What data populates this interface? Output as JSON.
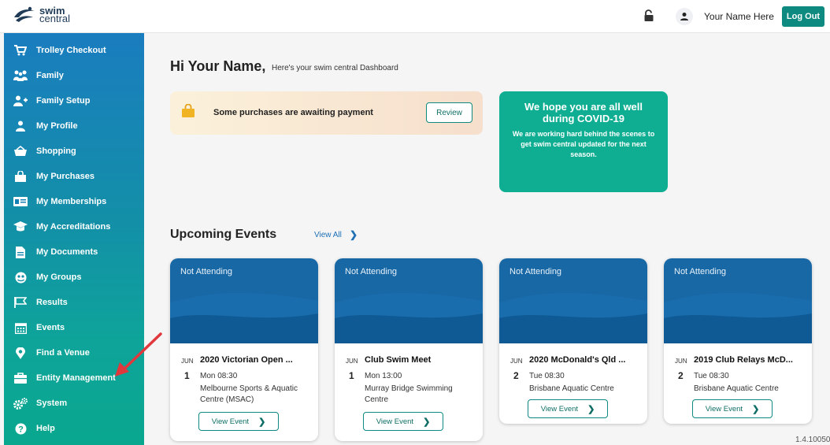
{
  "header": {
    "logo_line1": "swim",
    "logo_line2": "central",
    "user_name": "Your Name Here",
    "logout_label": "Log Out"
  },
  "sidebar": {
    "items": [
      {
        "label": "Trolley Checkout",
        "icon": "cart-icon"
      },
      {
        "label": "Family",
        "icon": "family-icon"
      },
      {
        "label": "Family Setup",
        "icon": "add-person-icon"
      },
      {
        "label": "My Profile",
        "icon": "person-icon"
      },
      {
        "label": "Shopping",
        "icon": "basket-icon"
      },
      {
        "label": "My Purchases",
        "icon": "bag-icon"
      },
      {
        "label": "My Memberships",
        "icon": "id-card-icon"
      },
      {
        "label": "My Accreditations",
        "icon": "graduation-cap-icon"
      },
      {
        "label": "My Documents",
        "icon": "document-icon"
      },
      {
        "label": "My Groups",
        "icon": "groups-icon"
      },
      {
        "label": "Results",
        "icon": "flag-icon"
      },
      {
        "label": "Events",
        "icon": "calendar-icon"
      },
      {
        "label": "Find a Venue",
        "icon": "location-pin-icon"
      },
      {
        "label": "Entity Management",
        "icon": "briefcase-icon"
      },
      {
        "label": "System",
        "icon": "cogs-icon"
      },
      {
        "label": "Help",
        "icon": "help-icon"
      }
    ]
  },
  "main": {
    "greeting": "Hi Your Name,",
    "greeting_sub": "Here's your swim central Dashboard",
    "payment_notice": "Some purchases are awaiting payment",
    "review_label": "Review",
    "covid_heading": "We hope you are all well during COVID-19",
    "covid_body": "We are working hard behind the scenes to get swim central updated for the next season.",
    "upcoming_title": "Upcoming Events",
    "view_all_label": "View All",
    "events": [
      {
        "status": "Not Attending",
        "month": "JUN",
        "day": "1",
        "title": "2020 Victorian Open ...",
        "time": "Mon 08:30",
        "venue": "Melbourne Sports & Aquatic Centre (MSAC)",
        "button": "View Event"
      },
      {
        "status": "Not Attending",
        "month": "JUN",
        "day": "1",
        "title": "Club Swim Meet",
        "time": "Mon 13:00",
        "venue": "Murray Bridge Swimming Centre",
        "button": "View Event"
      },
      {
        "status": "Not Attending",
        "month": "JUN",
        "day": "2",
        "title": "2020 McDonald's Qld ...",
        "time": "Tue 08:30",
        "venue": "Brisbane Aquatic Centre",
        "button": "View Event"
      },
      {
        "status": "Not Attending",
        "month": "JUN",
        "day": "2",
        "title": "2019 Club Relays McD...",
        "time": "Tue 08:30",
        "venue": "Brisbane Aquatic Centre",
        "button": "View Event"
      }
    ],
    "version": "1.4.10050"
  },
  "colors": {
    "accent": "#0e8a80",
    "event_header": "#1868a6",
    "covid_card": "#0fae93",
    "annotation_arrow": "#e0383d"
  }
}
